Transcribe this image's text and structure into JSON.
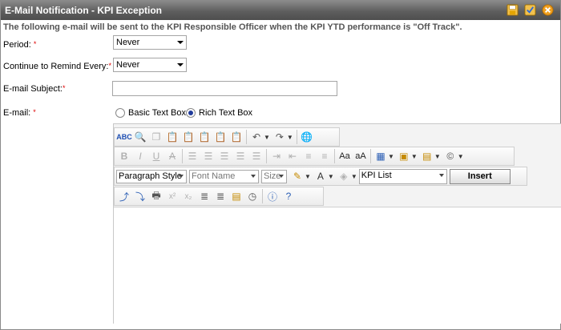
{
  "window": {
    "title": "E-Mail Notification - KPI Exception"
  },
  "title_icons": [
    "save-icon",
    "check-spelling-icon",
    "close-icon"
  ],
  "subtitle": "The following e-mail will be sent to the KPI Responsible Officer when the KPI YTD performance is \"Off Track\".",
  "form": {
    "period_label": "Period:",
    "period_value": "Never",
    "remind_label": "Continue to Remind Every:",
    "remind_value": "Never",
    "subject_label": "E-mail Subject:",
    "subject_value": "",
    "email_label": "E-mail:",
    "required_mark": "*"
  },
  "radios": {
    "basic_label": "Basic Text Box",
    "rich_label": "Rich Text Box",
    "selected": "rich"
  },
  "editor": {
    "paragraph_style": "Paragraph Style",
    "font_name": "Font Name",
    "size": "Size",
    "kpi_list": "KPI List",
    "insert_label": "Insert",
    "content": ""
  },
  "colors": {
    "titlebar": "#5e5e5e",
    "required": "#d00000",
    "subtitle": "#555555"
  }
}
